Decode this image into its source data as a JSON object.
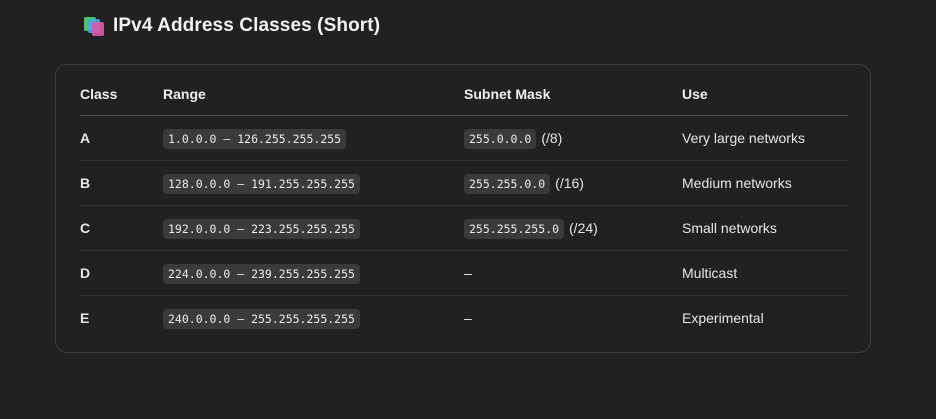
{
  "heading": {
    "title": "IPv4 Address Classes (Short)",
    "icon": "colored-squares-icon"
  },
  "table": {
    "headers": [
      "Class",
      "Range",
      "Subnet Mask",
      "Use"
    ],
    "rows": [
      {
        "class": "A",
        "range": "1.0.0.0 – 126.255.255.255",
        "mask": "255.0.0.0",
        "prefix": "(/8)",
        "use": "Very large networks"
      },
      {
        "class": "B",
        "range": "128.0.0.0 – 191.255.255.255",
        "mask": "255.255.0.0",
        "prefix": "(/16)",
        "use": "Medium networks"
      },
      {
        "class": "C",
        "range": "192.0.0.0 – 223.255.255.255",
        "mask": "255.255.255.0",
        "prefix": "(/24)",
        "use": "Small networks"
      },
      {
        "class": "D",
        "range": "224.0.0.0 – 239.255.255.255",
        "mask": "–",
        "prefix": "",
        "use": "Multicast"
      },
      {
        "class": "E",
        "range": "240.0.0.0 – 255.255.255.255",
        "mask": "–",
        "prefix": "",
        "use": "Experimental"
      }
    ]
  },
  "colors": {
    "background": "#212121",
    "card_border": "#3b3b3b",
    "code_background": "#3a3a3a",
    "text": "#ececec"
  }
}
